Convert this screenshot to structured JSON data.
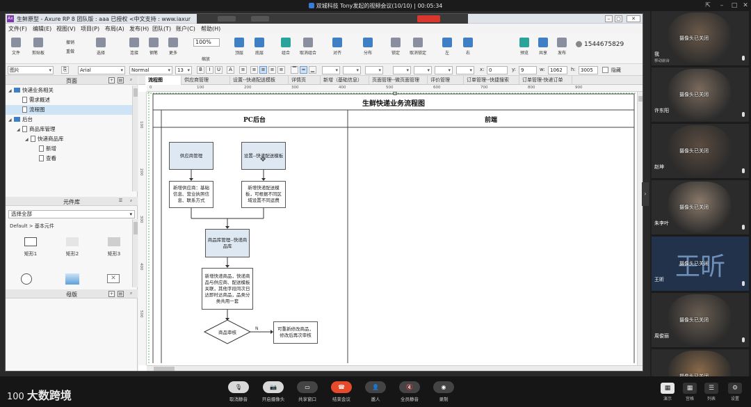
{
  "meeting": {
    "title": "双城科技 Tony发起的视频会议(10/10) | 00:05:34"
  },
  "axure": {
    "title": "生鲜原型 - Axure RP 8 团队版 : aaa 已授权     <中文支持 : www.iaxur",
    "menu": [
      "文件(F)",
      "编辑(E)",
      "视图(V)",
      "项目(P)",
      "布局(A)",
      "发布(H)",
      "团队(T)",
      "账户(C)",
      "帮助(H)"
    ],
    "toolbar": {
      "file": "文件",
      "clipboard": "剪贴板",
      "delete": "删除",
      "cut": "剪切",
      "copy": "复制",
      "undo": "撤销",
      "redo": "重做",
      "select": "选择",
      "connect": "连接",
      "pen": "钢笔",
      "more": "更多",
      "zoom_value": "100%",
      "zoom_label": "缩放",
      "top": "顶层",
      "bottom": "底层",
      "group": "组合",
      "ungroup": "取消组合",
      "align": "对齐",
      "distribute": "分布",
      "lock": "锁定",
      "unlock": "取消锁定",
      "left": "左",
      "right": "右",
      "preview": "预览",
      "share": "共享",
      "publish": "发布",
      "user": "1544675829"
    },
    "format": {
      "widget_type": "图片",
      "font": "Arial",
      "style": "Normal",
      "size": "13",
      "x_label": "x:",
      "x": "0",
      "y_label": "y:",
      "y": "9",
      "w_label": "w:",
      "w": "1062",
      "h_label": "h:",
      "h": "3005",
      "hidden": "隐藏"
    },
    "pages_panel": {
      "title": "页面",
      "items": [
        {
          "label": "快递业务相关",
          "level": 0,
          "kind": "folder",
          "toggle": "◢"
        },
        {
          "label": "需求概述",
          "level": 1,
          "kind": "page",
          "toggle": ""
        },
        {
          "label": "流程图",
          "level": 1,
          "kind": "page",
          "toggle": "",
          "selected": true
        },
        {
          "label": "后台",
          "level": 0,
          "kind": "folder",
          "toggle": "◢"
        },
        {
          "label": "商品库管理",
          "level": 1,
          "kind": "page",
          "toggle": "◢"
        },
        {
          "label": "快递商品库",
          "level": 2,
          "kind": "page",
          "toggle": "◢"
        },
        {
          "label": "新增",
          "level": 3,
          "kind": "page",
          "toggle": ""
        },
        {
          "label": "查看",
          "level": 3,
          "kind": "page",
          "toggle": ""
        }
      ]
    },
    "library_panel": {
      "title": "元件库",
      "select": "选择全部",
      "path": "Default > 基本元件",
      "widgets": [
        "矩形1",
        "矩形2",
        "矩形3"
      ]
    },
    "masters_panel": {
      "title": "母版"
    },
    "tabs": [
      "流程图",
      "供应商管理",
      "设置--快递配送模板",
      "详情页",
      "新增（基础信息）",
      "页面管理--微页面管理",
      "评价管理",
      "订单管理--快捷搜索",
      "订单管理-快递订单"
    ],
    "ruler_h": [
      "0",
      "100",
      "200",
      "300",
      "400",
      "500",
      "600",
      "700",
      "800",
      "900"
    ],
    "ruler_v": [
      "100",
      "200",
      "300",
      "400",
      "500"
    ],
    "diagram": {
      "title": "生鲜快递业务流程图",
      "lane_left": "PC后台",
      "lane_right": "前端",
      "nodes": {
        "n1": "供应商管理",
        "n2": "设置--快递配送模板",
        "n3": "新增供应商：基础信息、营业执照信息、联系方式",
        "n4": "新增快递配送模板，可根据不同区域设置不同运费",
        "n5": "商品库管理--快递商品库",
        "n6": "新增快递商品，快递商品与供应商、配送模板关联，其他字段同次日达即时达商品，品类分类共用一套",
        "n7": "商品审核",
        "n8": "可重新修改商品，修改后再次审核",
        "edge_no": "N"
      }
    }
  },
  "participants": [
    {
      "name": "我",
      "sub": "移动前台",
      "camera": "摄像头已关闭",
      "tone": "#6b5a4a"
    },
    {
      "name": "许东阳",
      "sub": "",
      "camera": "摄像头已关闭",
      "tone": "#7a6a5c"
    },
    {
      "name": "赵坤",
      "sub": "",
      "camera": "摄像头已关闭",
      "tone": "#5b4c40"
    },
    {
      "name": "朱李叶",
      "sub": "",
      "camera": "摄像头已关闭",
      "tone": "#8a7a6a"
    },
    {
      "name": "王昕",
      "sub": "",
      "camera": "摄像头已关闭",
      "avatar_text": "王昕",
      "tone": "#21324a"
    },
    {
      "name": "周俊丽",
      "sub": "",
      "camera": "摄像头已关闭",
      "tone": "#6a5e52"
    },
    {
      "name": "",
      "sub": "",
      "camera": "摄像头已关闭",
      "tone": "#8a6a4a"
    }
  ],
  "bottom": {
    "brand": "大数跨境",
    "brand_mark": "100",
    "controls": [
      {
        "label": "取消静音",
        "icon": "🎙",
        "style": "light"
      },
      {
        "label": "开启摄像头",
        "icon": "📷",
        "style": "light"
      },
      {
        "label": "共享窗口",
        "icon": "▭",
        "style": "dark"
      },
      {
        "label": "结束会议",
        "icon": "☎",
        "style": "red"
      },
      {
        "label": "邀人",
        "icon": "👤",
        "style": "dark"
      },
      {
        "label": "全员静音",
        "icon": "🔇",
        "style": "dark"
      },
      {
        "label": "录制",
        "icon": "◉",
        "style": "dark"
      }
    ],
    "right_controls": [
      {
        "label": "演示",
        "icon": "▦",
        "on": true
      },
      {
        "label": "宫格",
        "icon": "▦",
        "on": false
      },
      {
        "label": "列表",
        "icon": "☰",
        "on": false
      },
      {
        "label": "设置",
        "icon": "⚙",
        "on": false
      }
    ]
  }
}
